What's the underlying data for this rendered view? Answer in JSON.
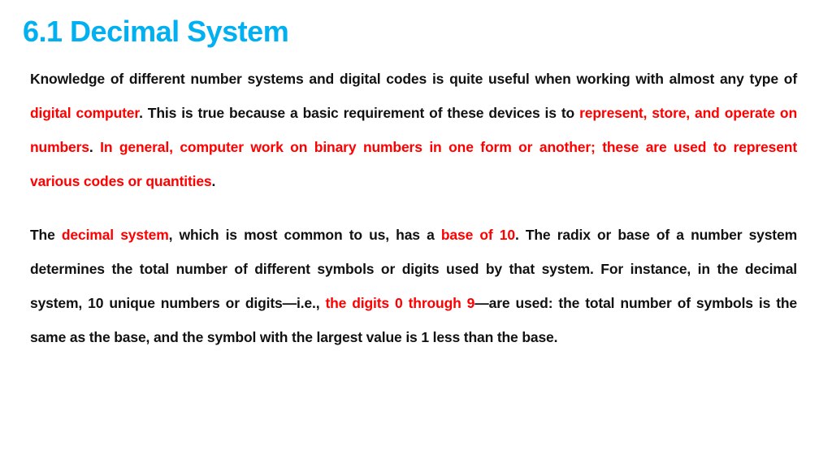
{
  "slide": {
    "title": "6.1 Decimal System",
    "colors": {
      "title": "#00B0F0",
      "highlight": "#FF0000",
      "text": "#111111"
    },
    "paragraph1": {
      "s1": "Knowledge of different number systems and digital codes is quite useful when working with almost any type of ",
      "h1": "digital computer",
      "s2": ". This is true because a basic requirement of these devices is to ",
      "h2": "represent, store, and operate on numbers",
      "s3": ". ",
      "h3": "In general, computer work on binary numbers in one form or another; these are used to represent various codes or quantities",
      "s4": "."
    },
    "paragraph2": {
      "s1": "The ",
      "h1": "decimal system",
      "s2": ", which is most common to us, has a ",
      "h2": "base of 10",
      "s3": ". The radix or base of a number system determines the total number of different symbols or digits used by that system. For instance, in the decimal system, 10 unique numbers or digits—i.e., ",
      "h3": "the digits 0 through 9",
      "s4": "—are used: the total number of symbols is the same as the base, and the symbol with the largest value is 1 less than the base."
    }
  }
}
